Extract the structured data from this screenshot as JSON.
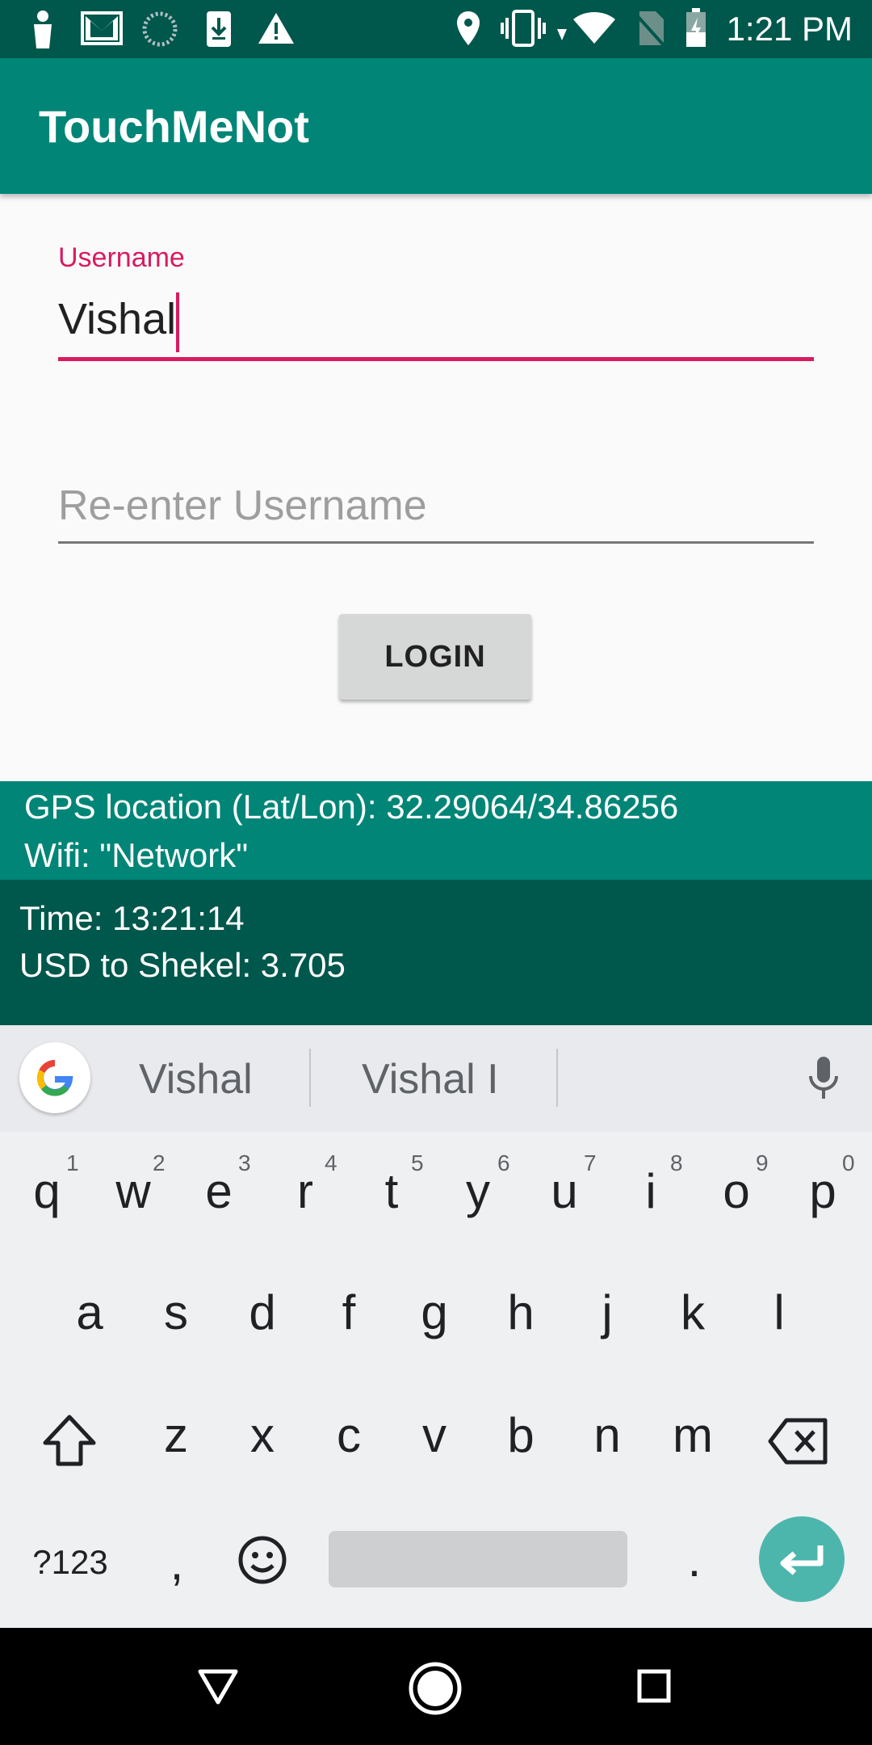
{
  "status_bar": {
    "time": "1:21 PM",
    "icons": [
      "person-icon",
      "gmail-icon",
      "sync-icon",
      "download-icon",
      "warning-icon",
      "location-icon",
      "vibrate-icon",
      "data-arrows-icon",
      "wifi-icon",
      "no-sim-icon",
      "battery-charging-icon"
    ]
  },
  "app_bar": {
    "title": "TouchMeNot"
  },
  "form": {
    "username_label": "Username",
    "username_value": "Vishal",
    "reenter_placeholder": "Re-enter Username",
    "login_label": "LOGIN"
  },
  "info": {
    "gps": "GPS location (Lat/Lon): 32.29064/34.86256",
    "wifi": "Wifi: \"Network\"",
    "time": "Time: 13:21:14",
    "currency": "USD to Shekel: 3.705"
  },
  "keyboard": {
    "suggestions": [
      "Vishal",
      "Vishal I"
    ],
    "row1": [
      "q",
      "w",
      "e",
      "r",
      "t",
      "y",
      "u",
      "i",
      "o",
      "p"
    ],
    "row1_nums": [
      "1",
      "2",
      "3",
      "4",
      "5",
      "6",
      "7",
      "8",
      "9",
      "0"
    ],
    "row2": [
      "a",
      "s",
      "d",
      "f",
      "g",
      "h",
      "j",
      "k",
      "l"
    ],
    "row3": [
      "z",
      "x",
      "c",
      "v",
      "b",
      "n",
      "m"
    ],
    "symbols_label": "?123",
    "comma": ",",
    "period": "."
  },
  "colors": {
    "primary": "#008577",
    "primary_dark": "#00574b",
    "accent": "#d81b60",
    "enter_key": "#4db6ac"
  }
}
